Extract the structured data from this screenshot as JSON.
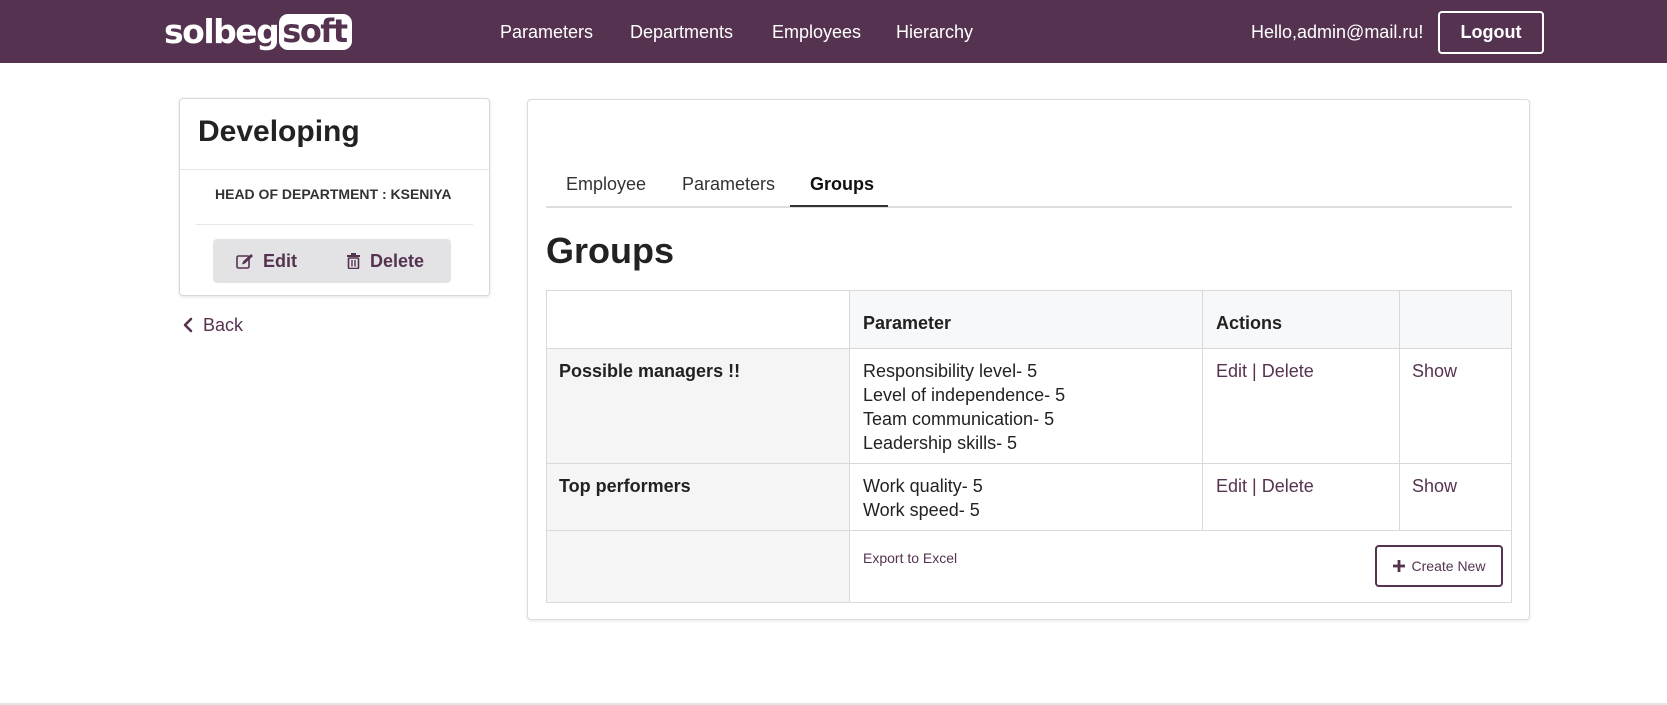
{
  "colors": {
    "brand": "#553350",
    "header_bg": "#553350",
    "link": "#553350"
  },
  "header": {
    "logo_part1": "solbeg",
    "logo_part2": "soft",
    "nav": [
      "Parameters",
      "Departments",
      "Employees",
      "Hierarchy"
    ],
    "greeting": "Hello,admin@mail.ru!",
    "logout_label": "Logout"
  },
  "department": {
    "title": "Developing",
    "head_line": "HEAD OF DEPARTMENT : KSENIYA",
    "edit_label": "Edit",
    "delete_label": "Delete",
    "edit_icon": "edit-icon",
    "delete_icon": "trash-icon"
  },
  "back": {
    "label": "Back",
    "icon": "chevron-left-icon"
  },
  "tabs": [
    {
      "label": "Employee",
      "active": false
    },
    {
      "label": "Parameters",
      "active": false
    },
    {
      "label": "Groups",
      "active": true
    }
  ],
  "groups": {
    "title": "Groups",
    "columns": [
      "",
      "Parameter",
      "Actions",
      ""
    ],
    "rows": [
      {
        "name": "Possible managers !!",
        "parameters": [
          "Responsibility level- 5",
          "Level of independence- 5",
          "Team communication- 5",
          "Leadership skills- 5"
        ],
        "edit": "Edit",
        "separator": "|",
        "delete": "Delete",
        "show": "Show"
      },
      {
        "name": "Top performers",
        "parameters": [
          "Work quality- 5",
          "Work speed- 5"
        ],
        "edit": "Edit",
        "separator": "|",
        "delete": "Delete",
        "show": "Show"
      }
    ],
    "export_label": "Export to Excel",
    "create_label": "Create New",
    "create_icon": "plus-icon"
  }
}
